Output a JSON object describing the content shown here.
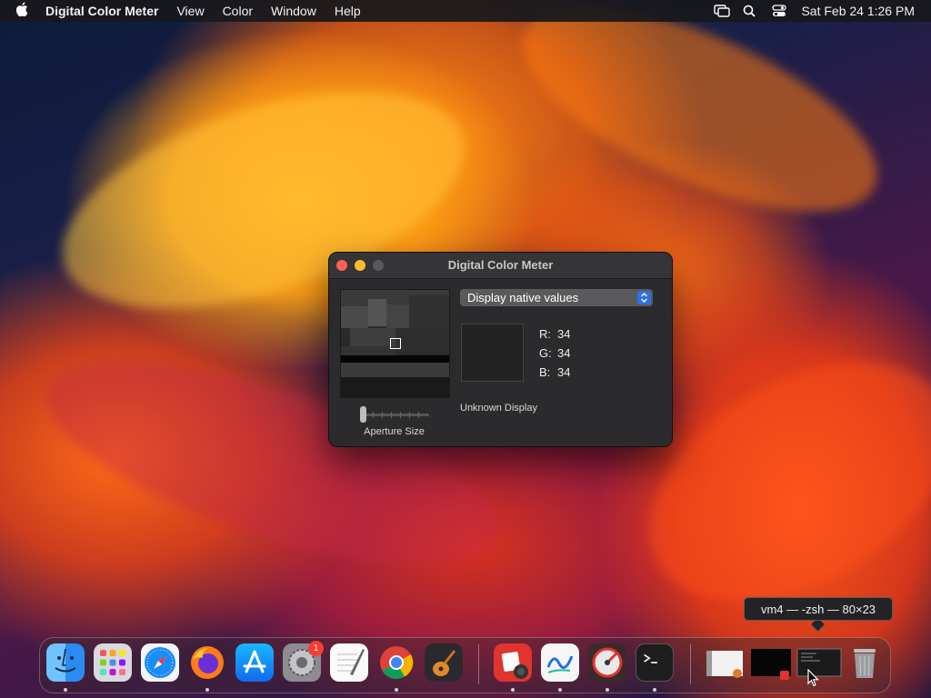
{
  "menubar": {
    "app_name": "Digital Color Meter",
    "menus": [
      "View",
      "Color",
      "Window",
      "Help"
    ],
    "clock": "Sat Feb 24  1:26 PM"
  },
  "window": {
    "title": "Digital Color Meter",
    "popup_value": "Display native values",
    "rgb": {
      "r_label": "R:",
      "r": "34",
      "g_label": "G:",
      "g": "34",
      "b_label": "B:",
      "b": "34"
    },
    "display_name": "Unknown Display",
    "aperture_label": "Aperture Size",
    "swatch_color": "#222222"
  },
  "tooltip": "vm4 — -zsh — 80×23",
  "dock": {
    "items": [
      "finder-icon",
      "launchpad-icon",
      "safari-icon",
      "firefox-icon",
      "app-store-icon",
      "system-settings-icon",
      "textedit-icon",
      "chrome-icon",
      "garageband-icon",
      "photo-booth-icon",
      "freeform-icon",
      "instruments-icon",
      "terminal-icon",
      "window-thumbnail-1",
      "window-thumbnail-2",
      "window-thumbnail-3",
      "trash-icon"
    ],
    "badge": "1"
  }
}
